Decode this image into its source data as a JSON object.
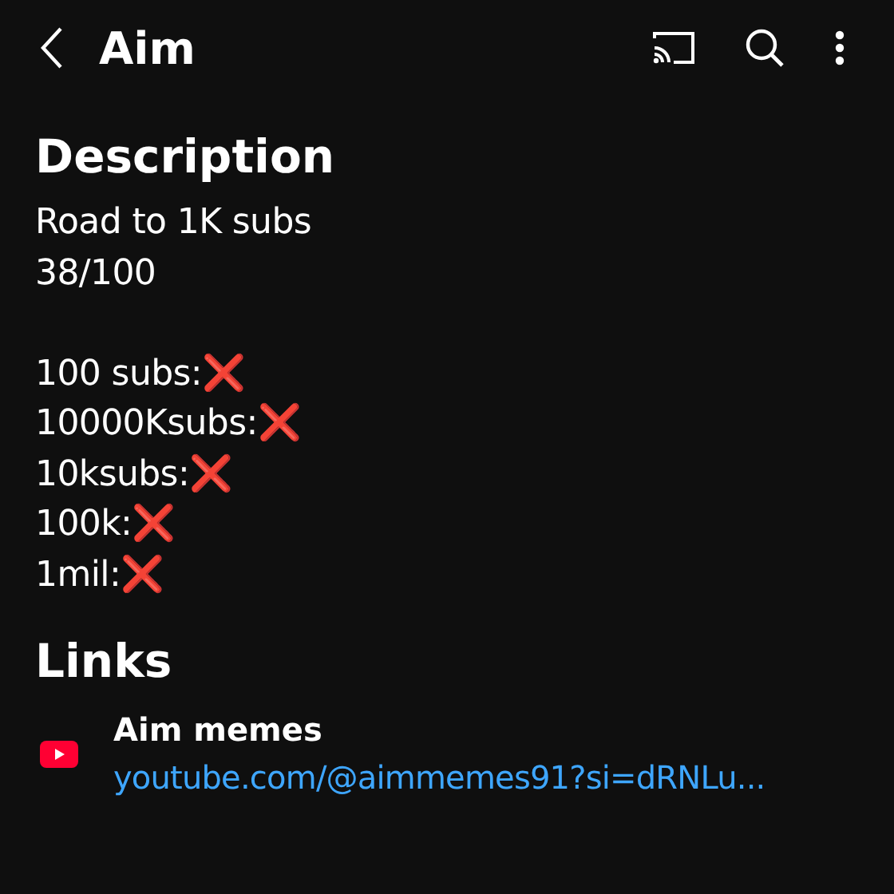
{
  "header": {
    "title": "Aim"
  },
  "description": {
    "heading": "Description",
    "text": "Road to 1K subs\n38/100\n\n100 subs:❌\n10000Ksubs:❌\n10ksubs:❌\n100k:❌\n1mil:❌"
  },
  "links": {
    "heading": "Links",
    "items": [
      {
        "title": "Aim memes",
        "url": "youtube.com/@aimmemes91?si=dRNLu..."
      }
    ]
  }
}
